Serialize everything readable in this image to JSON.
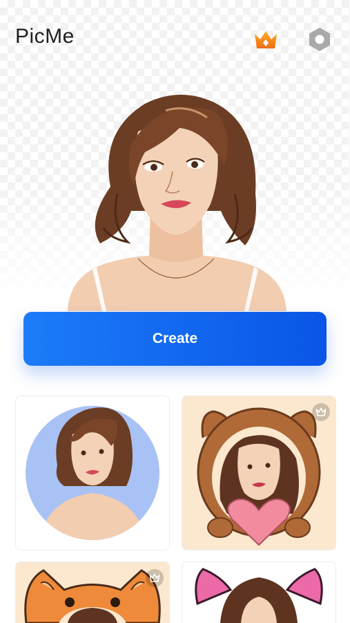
{
  "header": {
    "title": "PicMe",
    "premium_icon": "crown-icon",
    "settings_icon": "gear-icon"
  },
  "main": {
    "create_label": "Create"
  },
  "templates": [
    {
      "style": "circle-blue",
      "premium": false
    },
    {
      "style": "bear-hood-heart",
      "premium": true
    },
    {
      "style": "fox-hood",
      "premium": true
    },
    {
      "style": "cat-ears-pink",
      "premium": false
    }
  ],
  "colors": {
    "accent_start": "#1c7cf9",
    "accent_end": "#0a55e6",
    "crown": "#f08a1c"
  }
}
